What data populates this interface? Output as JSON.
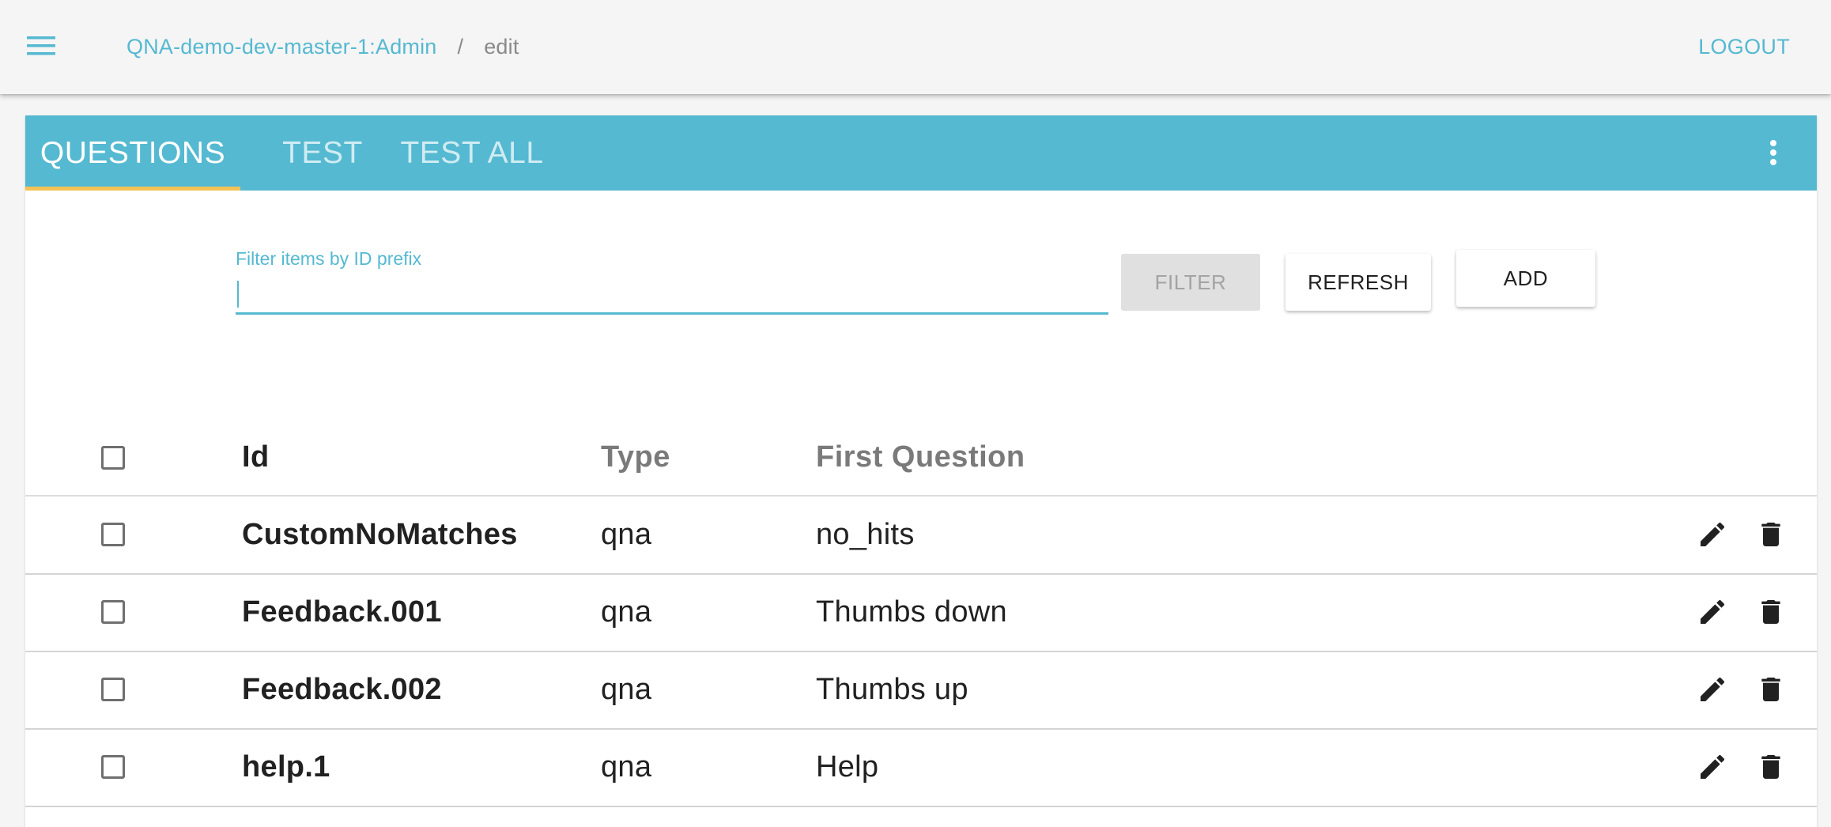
{
  "app": {
    "breadcrumb": {
      "project": "QNA-demo-dev-master-1:Admin",
      "separator": "/",
      "current": "edit"
    },
    "logout_label": "LOGOUT"
  },
  "tabs": [
    {
      "label": "QUESTIONS",
      "active": true
    },
    {
      "label": "TEST",
      "active": false
    },
    {
      "label": "TEST ALL",
      "active": false
    }
  ],
  "filter": {
    "label": "Filter items by ID prefix",
    "value": "",
    "filter_button": "FILTER",
    "refresh_button": "REFRESH",
    "add_button": "ADD"
  },
  "table": {
    "columns": [
      "Id",
      "Type",
      "First Question"
    ],
    "rows": [
      {
        "id": "CustomNoMatches",
        "type": "qna",
        "first_question": "no_hits"
      },
      {
        "id": "Feedback.001",
        "type": "qna",
        "first_question": "Thumbs down"
      },
      {
        "id": "Feedback.002",
        "type": "qna",
        "first_question": "Thumbs up"
      },
      {
        "id": "help.1",
        "type": "qna",
        "first_question": "Help"
      }
    ]
  },
  "colors": {
    "accent": "#55b9d1",
    "tab_indicator": "#f4c255",
    "background": "#f5f5f5"
  },
  "icons": {
    "menu": "hamburger-menu-icon",
    "more": "more-vert-icon",
    "edit": "pencil-icon",
    "delete": "trash-icon"
  }
}
